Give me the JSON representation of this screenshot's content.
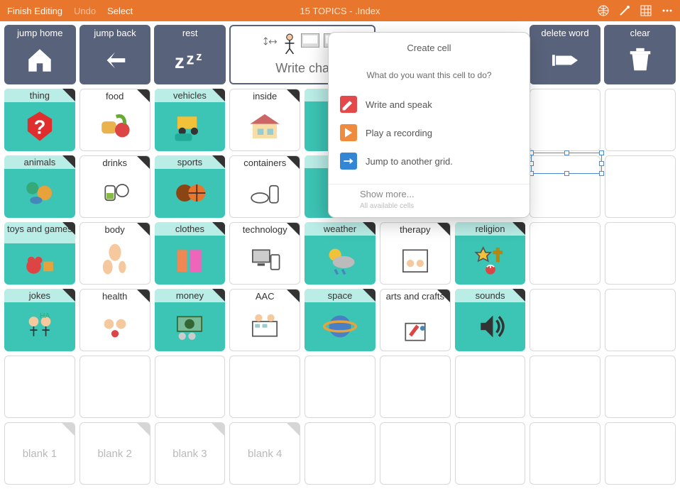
{
  "topbar": {
    "finish": "Finish Editing",
    "undo": "Undo",
    "select": "Select",
    "title": "15 TOPICS - .Index"
  },
  "header": {
    "jump_home": "jump home",
    "jump_back": "jump back",
    "rest": "rest",
    "write_chat": "Write cha",
    "delete_word": "delete word",
    "clear": "clear"
  },
  "popover": {
    "title": "Create cell",
    "subtitle": "What do you want this cell to do?",
    "opt1": "Write and speak",
    "opt2": "Play a recording",
    "opt3": "Jump to another grid.",
    "more": "Show more...",
    "more_sub": "All available cells"
  },
  "grid": {
    "row1": [
      {
        "label": "thing",
        "type": "teal",
        "icon": "question"
      },
      {
        "label": "food",
        "type": "white",
        "icon": "food"
      },
      {
        "label": "vehicles",
        "type": "teal",
        "icon": "vehicles"
      },
      {
        "label": "inside",
        "type": "white",
        "icon": "house"
      },
      {
        "label": "",
        "type": "teal",
        "icon": ""
      },
      {
        "label": "",
        "type": "empty"
      },
      {
        "label": "",
        "type": "empty"
      },
      {
        "label": "",
        "type": "empty"
      },
      {
        "label": "",
        "type": "empty"
      }
    ],
    "row2": [
      {
        "label": "animals",
        "type": "teal",
        "icon": "animals"
      },
      {
        "label": "drinks",
        "type": "white",
        "icon": "drinks"
      },
      {
        "label": "sports",
        "type": "teal",
        "icon": "sports"
      },
      {
        "label": "containers",
        "type": "white",
        "icon": "containers"
      },
      {
        "label": "",
        "type": "teal",
        "icon": ""
      },
      {
        "label": "",
        "type": "empty"
      },
      {
        "label": "",
        "type": "empty"
      },
      {
        "label": "",
        "type": "empty"
      },
      {
        "label": "",
        "type": "empty"
      }
    ],
    "row3": [
      {
        "label": "toys and games",
        "type": "teal",
        "icon": "toys",
        "two": true
      },
      {
        "label": "body",
        "type": "white",
        "icon": "body"
      },
      {
        "label": "clothes",
        "type": "teal",
        "icon": "clothes"
      },
      {
        "label": "technology",
        "type": "white",
        "icon": "tech"
      },
      {
        "label": "weather",
        "type": "teal",
        "icon": "weather"
      },
      {
        "label": "therapy",
        "type": "white",
        "icon": "therapy"
      },
      {
        "label": "religion",
        "type": "teal",
        "icon": "religion"
      },
      {
        "label": "",
        "type": "empty"
      },
      {
        "label": "",
        "type": "empty"
      }
    ],
    "row4": [
      {
        "label": "jokes",
        "type": "teal",
        "icon": "jokes"
      },
      {
        "label": "health",
        "type": "white",
        "icon": "health"
      },
      {
        "label": "money",
        "type": "teal",
        "icon": "money"
      },
      {
        "label": "AAC",
        "type": "white",
        "icon": "aac"
      },
      {
        "label": "space",
        "type": "teal",
        "icon": "space"
      },
      {
        "label": "arts and crafts",
        "type": "white",
        "icon": "arts",
        "two": true
      },
      {
        "label": "sounds",
        "type": "teal",
        "icon": "sounds"
      },
      {
        "label": "",
        "type": "empty"
      },
      {
        "label": "",
        "type": "empty"
      }
    ],
    "row5": [
      {
        "type": "empty"
      },
      {
        "type": "empty"
      },
      {
        "type": "empty"
      },
      {
        "type": "empty"
      },
      {
        "type": "empty"
      },
      {
        "type": "empty"
      },
      {
        "type": "empty"
      },
      {
        "type": "empty"
      },
      {
        "type": "empty"
      }
    ],
    "row6": [
      {
        "label": "blank 1",
        "type": "blank"
      },
      {
        "label": "blank 2",
        "type": "blank"
      },
      {
        "label": "blank 3",
        "type": "blank"
      },
      {
        "label": "blank 4",
        "type": "blank"
      },
      {
        "type": "empty"
      },
      {
        "type": "empty"
      },
      {
        "type": "empty"
      },
      {
        "type": "empty"
      },
      {
        "type": "empty"
      }
    ]
  },
  "colors": {
    "orange": "#E8762D",
    "slate": "#58627A",
    "teal": "#3CC4B4",
    "red": "#E54848",
    "playOrange": "#F08A3C",
    "blue": "#3386D6"
  }
}
